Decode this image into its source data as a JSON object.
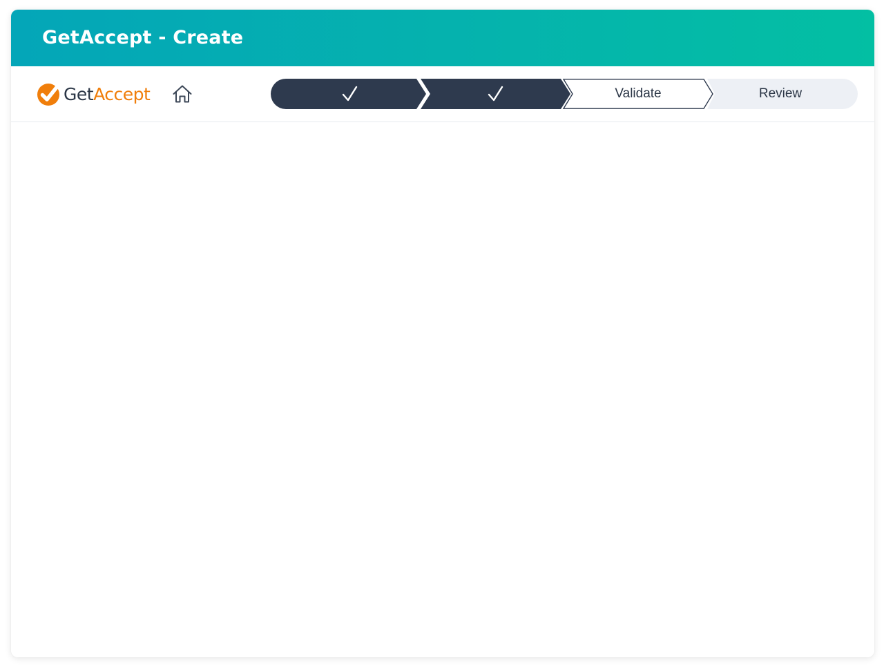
{
  "window": {
    "title": "GetAccept - Create"
  },
  "header": {
    "logo": {
      "text_get": "Get",
      "text_accept": "Accept",
      "icon": "getaccept-check-logo-icon"
    },
    "home_icon": "home-icon"
  },
  "stepper": {
    "steps": [
      {
        "label": "",
        "state": "completed",
        "icon": "checkmark-icon"
      },
      {
        "label": "",
        "state": "completed",
        "icon": "checkmark-icon"
      },
      {
        "label": "Validate",
        "state": "current"
      },
      {
        "label": "Review",
        "state": "upcoming"
      }
    ]
  },
  "colors": {
    "header_gradient_start": "#04a6b8",
    "header_gradient_end": "#03bfa3",
    "step_completed": "#2e3a4e",
    "step_upcoming": "#edf0f5",
    "logo_orange": "#f07e0b",
    "text_dark": "#2b3646"
  }
}
